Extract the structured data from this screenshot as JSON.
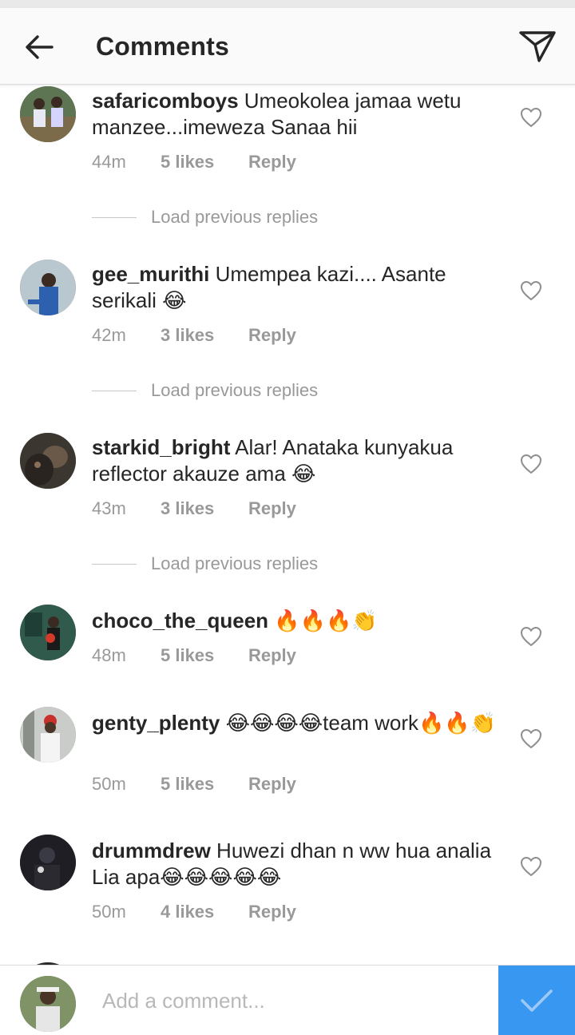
{
  "header": {
    "title": "Comments",
    "back_icon": "arrow-left-icon",
    "send_icon": "paper-plane-icon"
  },
  "load_previous_label": "Load previous replies",
  "comments": [
    {
      "user": "safaricomboys",
      "text": "Umeokolea jamaa wetu manzee...imeweza Sanaa hii",
      "time": "44m",
      "likes": "5 likes",
      "reply": "Reply"
    },
    {
      "user": "gee_murithi",
      "text": "Umempea kazi.... Asante serikali 😂",
      "time": "42m",
      "likes": "3 likes",
      "reply": "Reply"
    },
    {
      "user": "starkid_bright",
      "text": "Alar! Anataka kunyakua reflector akauze ama 😂",
      "time": "43m",
      "likes": "3 likes",
      "reply": "Reply"
    },
    {
      "user": "choco_the_queen",
      "text": "🔥🔥🔥👏",
      "time": "48m",
      "likes": "5 likes",
      "reply": "Reply"
    },
    {
      "user": "genty_plenty",
      "text": "😂😂😂😂team work🔥🔥👏",
      "time": "50m",
      "likes": "5 likes",
      "reply": "Reply"
    },
    {
      "user": "drummdrew",
      "text": "Huwezi dhan n ww hua analia Lia apa😂😂😂😂😂",
      "time": "50m",
      "likes": "4 likes",
      "reply": "Reply"
    }
  ],
  "composer": {
    "placeholder": "Add a comment...",
    "post_icon": "checkmark-icon"
  },
  "colors": {
    "accent": "#3897f0",
    "meta_text": "#999999",
    "primary_text": "#262626"
  }
}
